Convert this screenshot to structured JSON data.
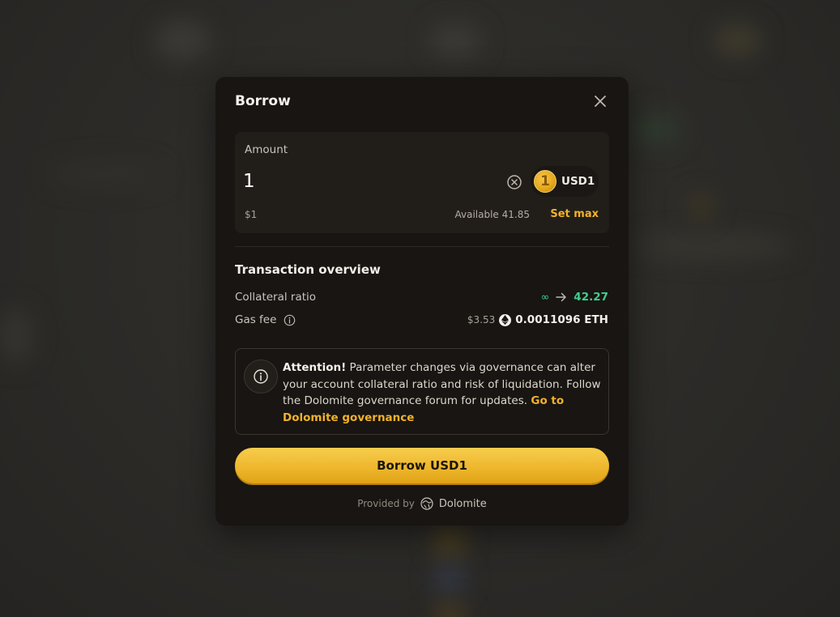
{
  "modal": {
    "title": "Borrow",
    "close_icon": "close-icon"
  },
  "amount": {
    "label": "Amount",
    "value": "1",
    "usd_value": "$1",
    "available_label": "Available",
    "available_value": "41.85",
    "set_max_label": "Set max",
    "token": {
      "symbol": "USD1",
      "coin_glyph": "1",
      "icon": "usd1-coin-icon"
    }
  },
  "overview": {
    "title": "Transaction overview",
    "collateral_ratio": {
      "label": "Collateral ratio",
      "from": "∞",
      "to": "42.27"
    },
    "gas_fee": {
      "label": "Gas fee",
      "usd": "$3.53",
      "amount": "0.0011096 ETH"
    }
  },
  "attention": {
    "heading": "Attention!",
    "body": "Parameter changes via governance can alter your account collateral ratio and risk of liquidation. Follow the Dolomite governance forum for updates.",
    "link": "Go to Dolomite governance"
  },
  "borrow_button_label": "Borrow USD1",
  "footer": {
    "provided_by": "Provided by",
    "provider": "Dolomite"
  },
  "colors": {
    "accent": "#f2b22a",
    "positive": "#3fcf8e",
    "modal_bg": "#181512"
  }
}
